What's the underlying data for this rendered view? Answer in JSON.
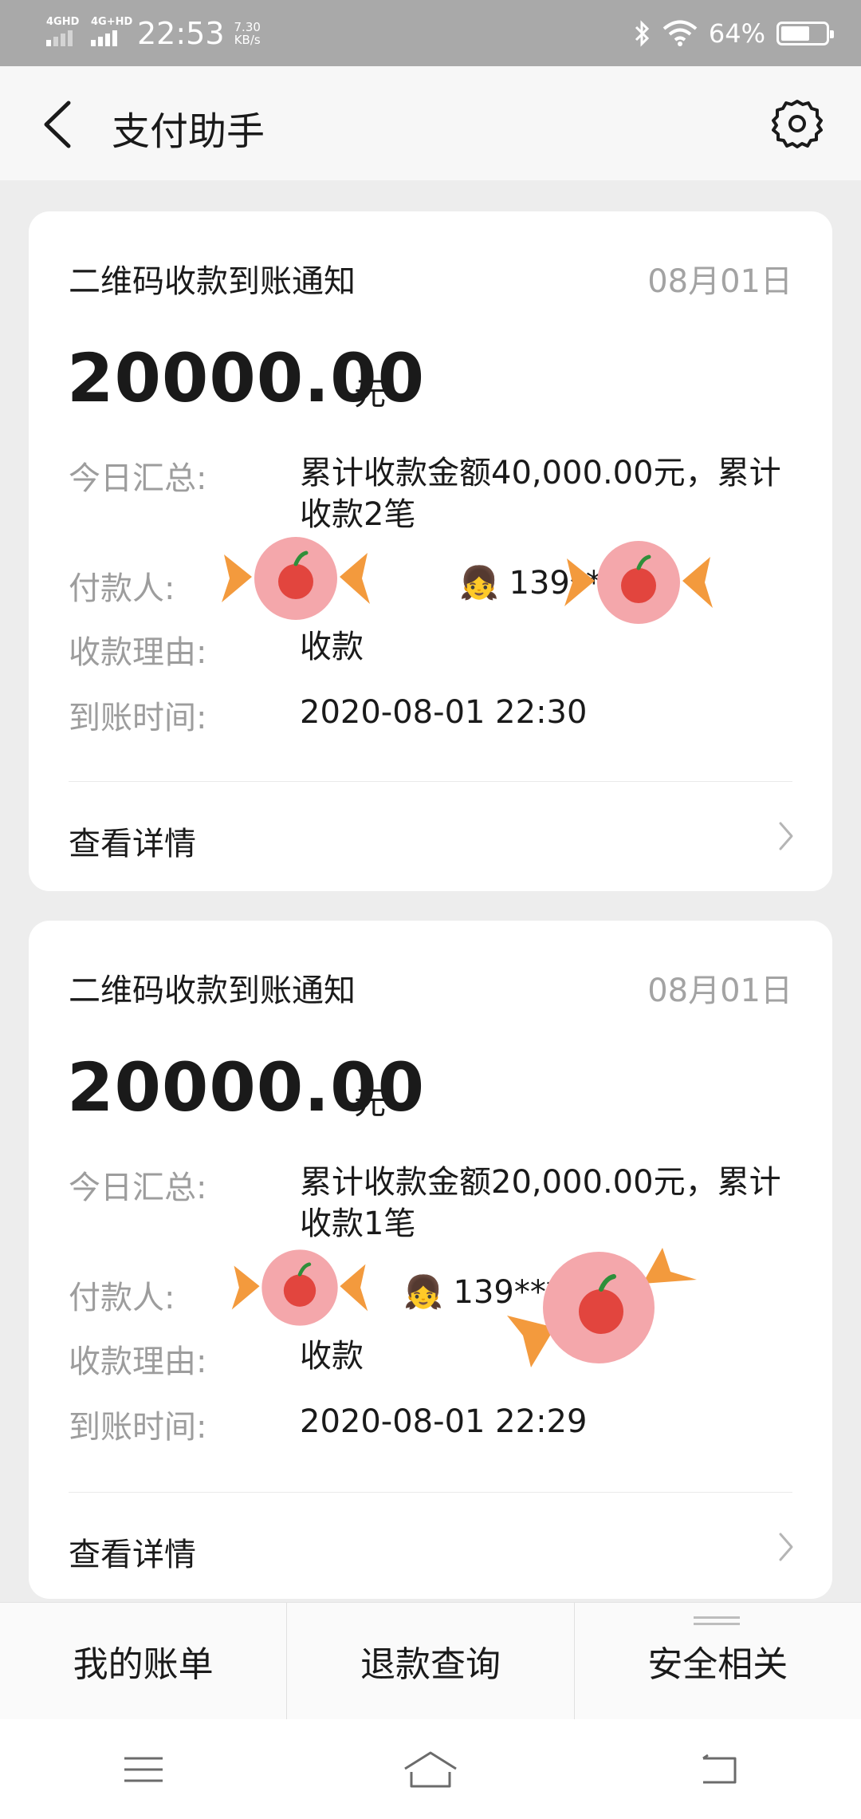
{
  "status_bar": {
    "sim1": "4GHD",
    "sim2": "4G+HD",
    "time": "22:53",
    "speed_value": "7.30",
    "speed_unit": "KB/s",
    "battery": "64%"
  },
  "header": {
    "title": "支付助手"
  },
  "cards": [
    {
      "title": "二维码收款到账通知",
      "date": "08月01日",
      "amount": "20000.00",
      "unit": "元",
      "summary_label": "今日汇总:",
      "summary_value": "累计收款金额40,000.00元，累计收款2笔",
      "payer_label": "付款人:",
      "payer_value": "139****",
      "reason_label": "收款理由:",
      "reason_value": "收款",
      "time_label": "到账时间:",
      "time_value": "2020-08-01 22:30",
      "detail_link": "查看详情"
    },
    {
      "title": "二维码收款到账通知",
      "date": "08月01日",
      "amount": "20000.00",
      "unit": "元",
      "summary_label": "今日汇总:",
      "summary_value": "累计收款金额20,000.00元，累计收款1笔",
      "payer_label": "付款人:",
      "payer_value": "139****",
      "reason_label": "收款理由:",
      "reason_value": "收款",
      "time_label": "到账时间:",
      "time_value": "2020-08-01 22:29",
      "detail_link": "查看详情"
    }
  ],
  "bottom_menu": {
    "items": [
      "我的账单",
      "退款查询",
      "安全相关"
    ]
  },
  "colors": {
    "status_bar": "#a9a9a9",
    "background": "#ededed",
    "card": "#ffffff",
    "muted_text": "#9d9d9d",
    "candy_pink": "#f4a7ab",
    "candy_orange": "#f39a3d"
  },
  "icons": {
    "back": "chevron-left-icon",
    "settings": "gear-icon",
    "detail": "chevron-right-icon",
    "nav": [
      "menu-icon",
      "home-icon",
      "back-arrow-icon"
    ]
  }
}
